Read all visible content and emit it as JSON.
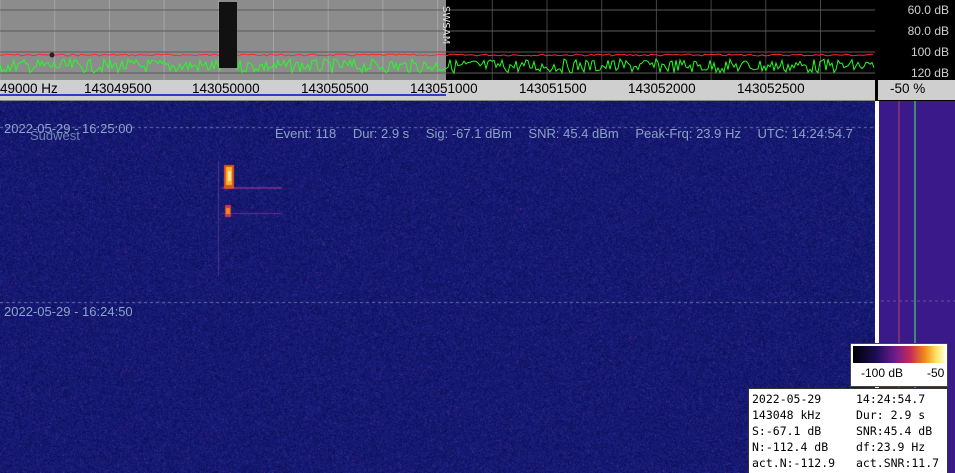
{
  "db_scale": [
    "60.0 dB",
    "80.0 dB",
    "100 dB",
    "120 dB"
  ],
  "freq_axis": {
    "labels": [
      "49000 Hz",
      "143049500",
      "143050000",
      "143050500",
      "143051000",
      "143051500",
      "143052000",
      "143052500"
    ],
    "percent": "-50 %"
  },
  "signal_marker_text": "SWSAM",
  "waterfall": {
    "time_top": "2022-05-29 - 16:25:00",
    "time_mid": "2022-05-29 - 16:24:50",
    "station": "Südwest",
    "event": {
      "event": "Event: 118",
      "dur": "Dur: 2.9 s",
      "sig": "Sig: -67.1 dBm",
      "snr": "SNR: 45.4 dBm",
      "peak": "Peak-Frq: 23.9 Hz",
      "utc": "UTC: 14:24:54.7"
    }
  },
  "colorbar": {
    "min_label": "-100 dB",
    "max_label": "-50"
  },
  "info_box": {
    "rows": [
      {
        "l": "2022-05-29",
        "r": "14:24:54.7"
      },
      {
        "l": "143048 kHz",
        "r": "Dur: 2.9 s"
      },
      {
        "l": "S:-67.1 dB",
        "r": "SNR:45.4 dB"
      },
      {
        "l": "N:-112.4 dB",
        "r": "df:23.9 Hz"
      },
      {
        "l": "act.N:-112.9",
        "r": "act.SNR:11.7"
      }
    ]
  },
  "colors": {
    "waterfall_bg": "#10126a",
    "spectrum_green": "#22ff22",
    "spectrum_red": "#ff2a2a",
    "freq_blue": "#2b3ecf"
  }
}
